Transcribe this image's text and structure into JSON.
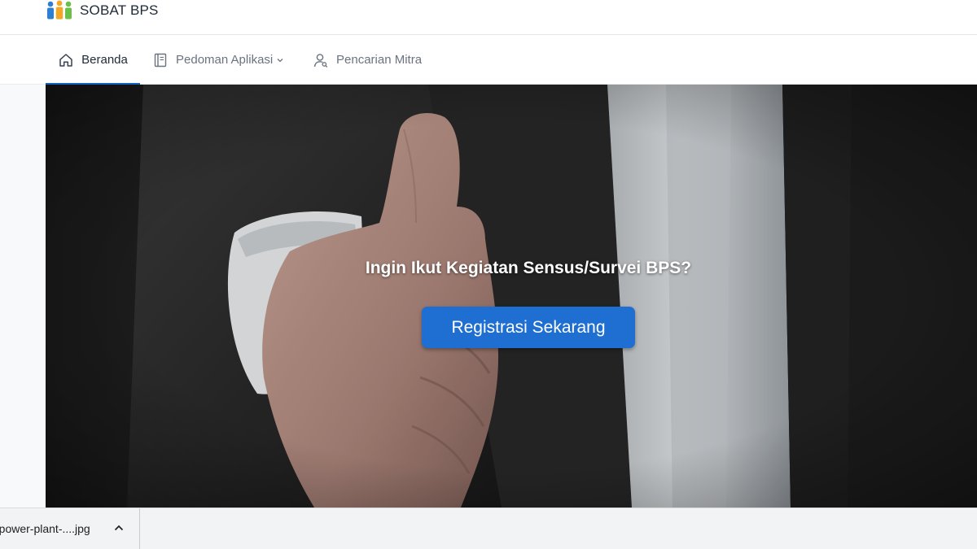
{
  "app": {
    "name": "SOBAT BPS",
    "logo_icon": "people-group-icon",
    "logo_colors": [
      "#2f7fd0",
      "#f5a623",
      "#6cc04a"
    ]
  },
  "nav": {
    "items": [
      {
        "label": "Beranda",
        "icon": "home-icon",
        "active": true
      },
      {
        "label": "Pedoman Aplikasi",
        "icon": "book-icon",
        "has_dropdown": true
      },
      {
        "label": "Pencarian Mitra",
        "icon": "user-search-icon"
      }
    ],
    "active_color": "#1565c0"
  },
  "hero": {
    "heading": "Ingin Ikut Kegiatan Sensus/Survei BPS?",
    "button_label": "Registrasi Sekarang",
    "button_color": "#1e6fd1",
    "background_image": "businessman-handshake-photo"
  },
  "download_bar": {
    "file_name": "-power-plant-....jpg",
    "chevron_icon": "chevron-up-icon"
  }
}
